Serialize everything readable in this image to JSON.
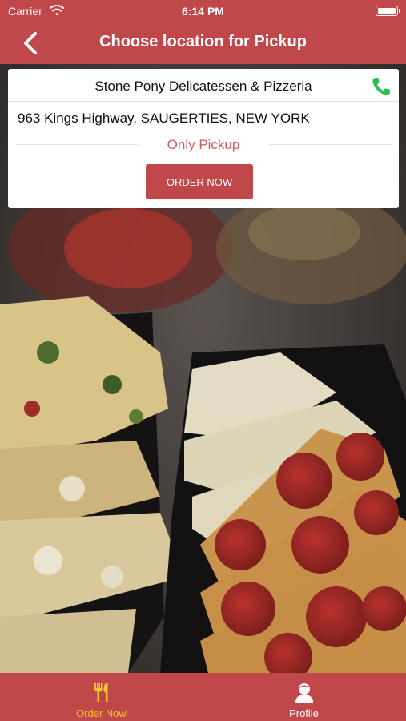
{
  "status_bar": {
    "carrier": "Carrier",
    "time": "6:14 PM"
  },
  "nav": {
    "title": "Choose location for Pickup",
    "back_icon": "chevron-left-icon"
  },
  "location": {
    "store_name": "Stone Pony Delicatessen & Pizzeria",
    "address": "963 Kings Highway, SAUGERTIES, NEW YORK",
    "mode": "Only Pickup",
    "order_button": "ORDER NOW",
    "phone_icon": "phone-icon"
  },
  "tabs": [
    {
      "label": "Order Now",
      "icon": "utensils-icon",
      "active": true
    },
    {
      "label": "Profile",
      "icon": "user-icon",
      "active": false
    }
  ],
  "colors": {
    "brand": "#c0474a",
    "active_tab": "#f4c430",
    "phone": "#2fbf4f",
    "mode_text": "#d25a5c"
  }
}
